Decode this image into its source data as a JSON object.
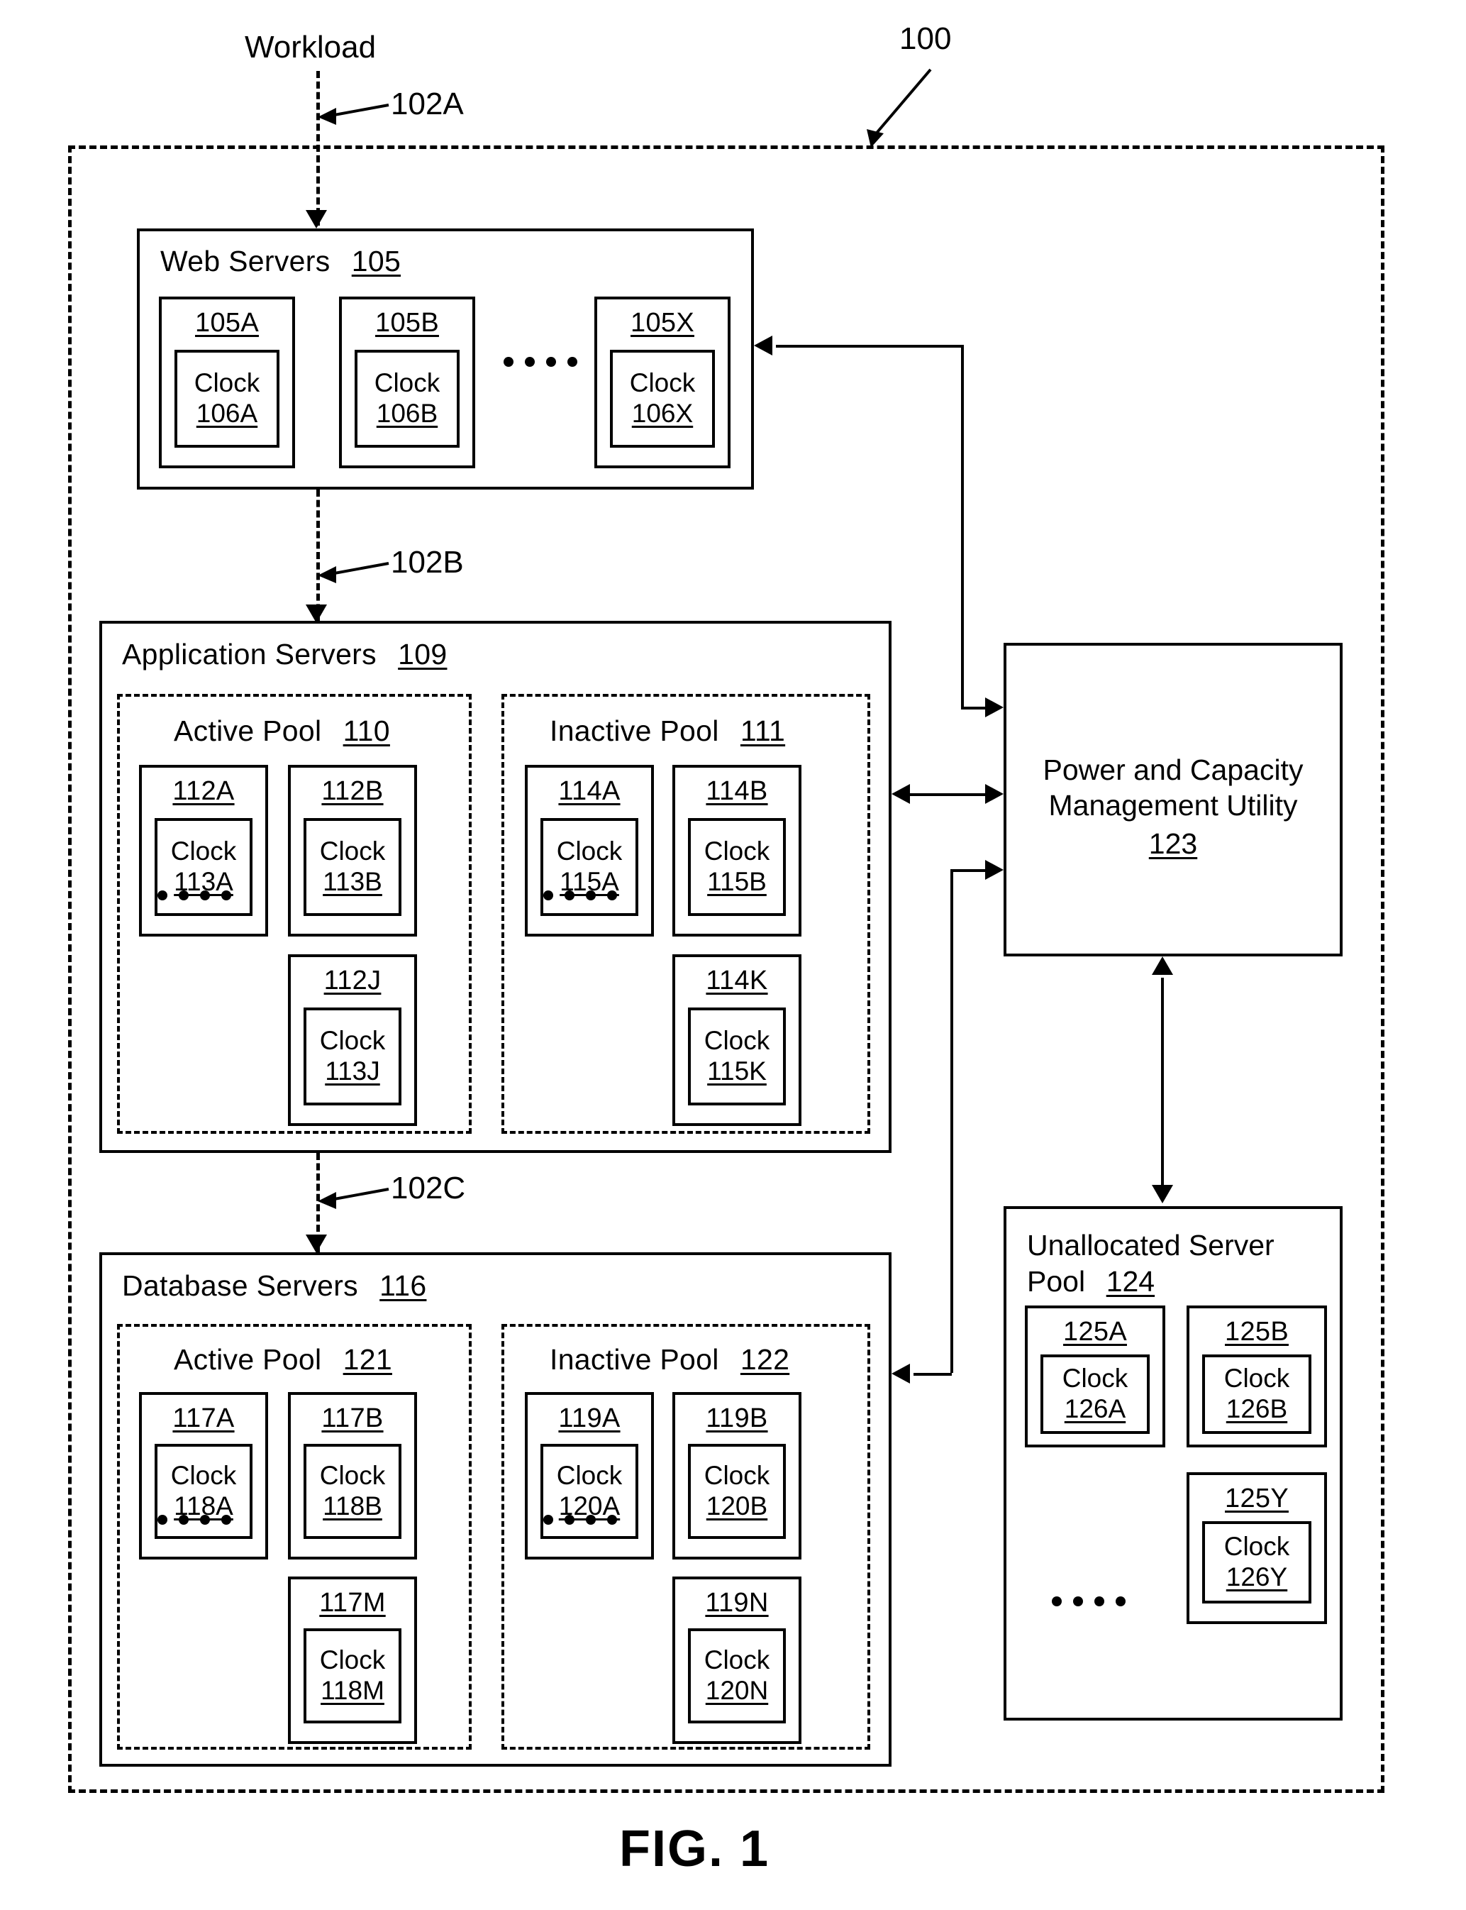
{
  "figure": {
    "caption": "FIG. 1",
    "system_ref": "100",
    "workload_label": "Workload",
    "flow_refs": [
      "102A",
      "102B",
      "102C"
    ]
  },
  "web_servers": {
    "title": "Web Servers",
    "ref": "105",
    "servers": [
      {
        "id": "105A",
        "clock_word": "Clock",
        "clock_id": "106A"
      },
      {
        "id": "105B",
        "clock_word": "Clock",
        "clock_id": "106B"
      },
      {
        "id": "105X",
        "clock_word": "Clock",
        "clock_id": "106X"
      }
    ],
    "ellipsis": "...."
  },
  "application_servers": {
    "title": "Application Servers",
    "ref": "109",
    "active_pool": {
      "title": "Active Pool",
      "ref": "110",
      "ellipsis": "....",
      "servers": [
        {
          "id": "112A",
          "clock_word": "Clock",
          "clock_id": "113A"
        },
        {
          "id": "112B",
          "clock_word": "Clock",
          "clock_id": "113B"
        },
        {
          "id": "112J",
          "clock_word": "Clock",
          "clock_id": "113J"
        }
      ]
    },
    "inactive_pool": {
      "title": "Inactive Pool",
      "ref": "111",
      "ellipsis": "....",
      "servers": [
        {
          "id": "114A",
          "clock_word": "Clock",
          "clock_id": "115A"
        },
        {
          "id": "114B",
          "clock_word": "Clock",
          "clock_id": "115B"
        },
        {
          "id": "114K",
          "clock_word": "Clock",
          "clock_id": "115K"
        }
      ]
    }
  },
  "database_servers": {
    "title": "Database Servers",
    "ref": "116",
    "active_pool": {
      "title": "Active Pool",
      "ref": "121",
      "ellipsis": "....",
      "servers": [
        {
          "id": "117A",
          "clock_word": "Clock",
          "clock_id": "118A"
        },
        {
          "id": "117B",
          "clock_word": "Clock",
          "clock_id": "118B"
        },
        {
          "id": "117M",
          "clock_word": "Clock",
          "clock_id": "118M"
        }
      ]
    },
    "inactive_pool": {
      "title": "Inactive Pool",
      "ref": "122",
      "ellipsis": "....",
      "servers": [
        {
          "id": "119A",
          "clock_word": "Clock",
          "clock_id": "120A"
        },
        {
          "id": "119B",
          "clock_word": "Clock",
          "clock_id": "120B"
        },
        {
          "id": "119N",
          "clock_word": "Clock",
          "clock_id": "120N"
        }
      ]
    }
  },
  "power_utility": {
    "line1": "Power and Capacity",
    "line2": "Management Utility",
    "ref": "123"
  },
  "unallocated_pool": {
    "line1": "Unallocated Server",
    "line2": "Pool",
    "ref": "124",
    "ellipsis": "....",
    "servers": [
      {
        "id": "125A",
        "clock_word": "Clock",
        "clock_id": "126A"
      },
      {
        "id": "125B",
        "clock_word": "Clock",
        "clock_id": "126B"
      },
      {
        "id": "125Y",
        "clock_word": "Clock",
        "clock_id": "126Y"
      }
    ]
  },
  "colors": {
    "ink": "#000000",
    "paper": "#ffffff"
  }
}
